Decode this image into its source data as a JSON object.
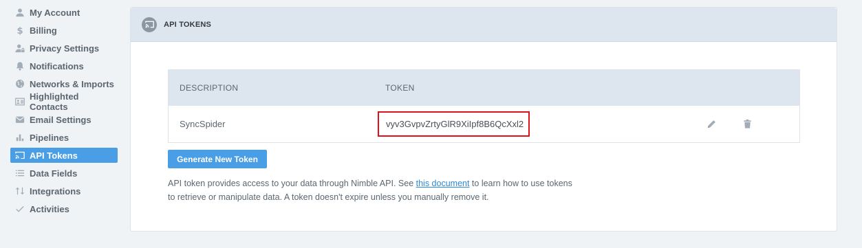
{
  "sidebar": {
    "items": [
      {
        "label": "My Account",
        "icon": "user-icon"
      },
      {
        "label": "Billing",
        "icon": "dollar-icon"
      },
      {
        "label": "Privacy Settings",
        "icon": "user-lock-icon"
      },
      {
        "label": "Notifications",
        "icon": "bell-icon"
      },
      {
        "label": "Networks & Imports",
        "icon": "globe-icon"
      },
      {
        "label": "Highlighted Contacts",
        "icon": "contact-card-icon"
      },
      {
        "label": "Email Settings",
        "icon": "envelope-icon"
      },
      {
        "label": "Pipelines",
        "icon": "bar-chart-icon"
      },
      {
        "label": "API Tokens",
        "icon": "cast-icon",
        "active": true
      },
      {
        "label": "Data Fields",
        "icon": "list-icon"
      },
      {
        "label": "Integrations",
        "icon": "integrations-icon"
      },
      {
        "label": "Activities",
        "icon": "check-icon"
      }
    ]
  },
  "panel": {
    "title": "API TOKENS",
    "icon": "cast-icon"
  },
  "table": {
    "headers": {
      "description": "DESCRIPTION",
      "token": "TOKEN"
    },
    "rows": [
      {
        "description": "SyncSpider",
        "token": "vyv3GvpvZrtyGlR9XiIpf8B6QcXxl2"
      }
    ]
  },
  "generate_button": "Generate New Token",
  "help": {
    "before": "API token provides access to your data through Nimble API. See ",
    "link": "this document",
    "after": " to learn how to use tokens to retrieve or manipulate data. A token doesn't expire unless you manually remove it."
  },
  "colors": {
    "accent": "#4a9ee6",
    "highlight_border": "#e0101a",
    "header_bg": "#dde6ee"
  }
}
